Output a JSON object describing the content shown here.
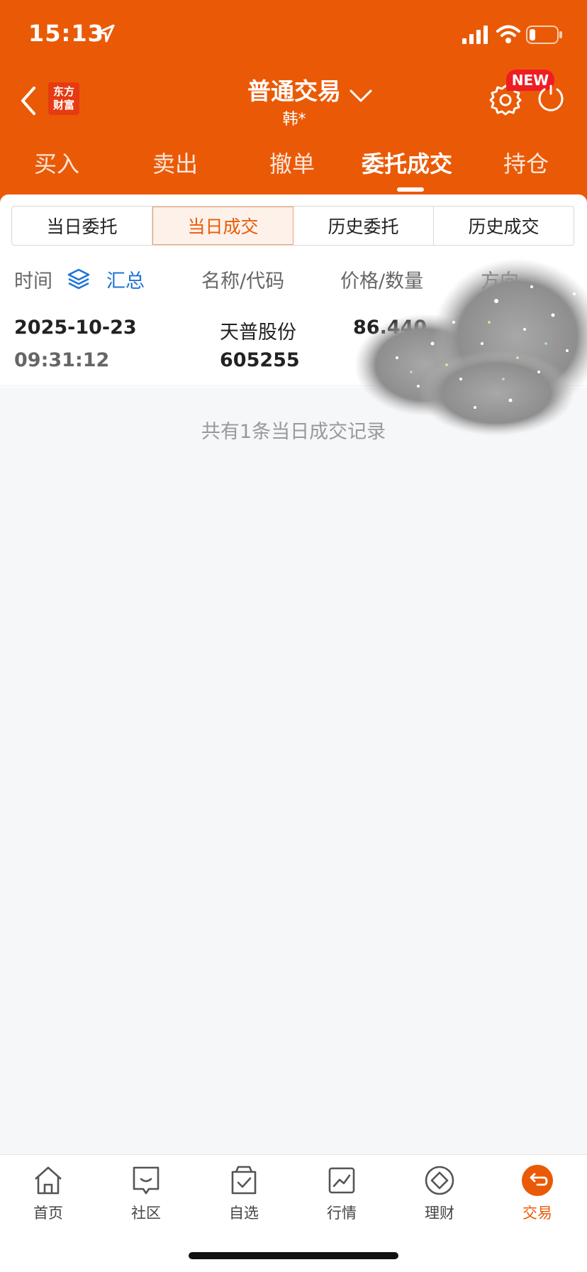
{
  "status_bar": {
    "time": "15:13"
  },
  "header": {
    "brand_logo": [
      "东方",
      "财富"
    ],
    "title": "普通交易",
    "subtitle": "韩*",
    "new_badge": "NEW"
  },
  "main_tabs": [
    "买入",
    "卖出",
    "撤单",
    "委托成交",
    "持仓"
  ],
  "segments": [
    "当日委托",
    "当日成交",
    "历史委托",
    "历史成交"
  ],
  "columns": {
    "time": "时间",
    "summary_link": "汇总",
    "name_code": "名称/代码",
    "price_qty": "价格/数量",
    "direction": "方向"
  },
  "trades": [
    {
      "date": "2025-10-23",
      "time": "09:31:12",
      "name": "天普股份",
      "code": "605255",
      "price": "86.440"
    }
  ],
  "summary_text": "共有1条当日成交记录",
  "bottom_nav": [
    "首页",
    "社区",
    "自选",
    "行情",
    "理财",
    "交易"
  ],
  "colors": {
    "brand": "#ea5a06",
    "link": "#1d73d6",
    "badge": "#ee1d23"
  }
}
